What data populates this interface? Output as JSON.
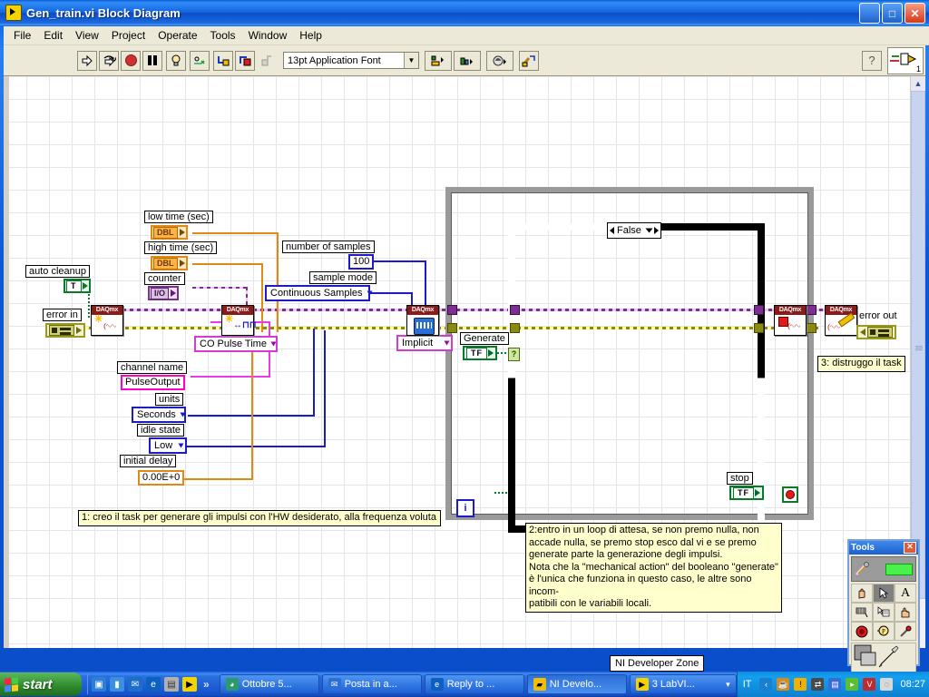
{
  "window": {
    "title": "Gen_train.vi Block Diagram",
    "icon": "labview-vi-icon",
    "minimize": "_",
    "maximize": "□",
    "close": "✕"
  },
  "menu": {
    "items": [
      "File",
      "Edit",
      "View",
      "Project",
      "Operate",
      "Tools",
      "Window",
      "Help"
    ]
  },
  "toolbar": {
    "run": "run-arrow-icon",
    "run_continuous": "run-continuous-icon",
    "abort": "abort-execution-icon",
    "pause": "pause-icon",
    "highlight": "highlight-execution-icon",
    "retain_wire": "retain-wire-values-icon",
    "step_into": "step-into-icon",
    "step_over": "step-over-icon",
    "step_out": "step-out-icon",
    "font": "13pt Application Font",
    "align": "align-objects-icon",
    "distribute": "distribute-objects-icon",
    "reorder": "reorder-icon",
    "cleanup": "clean-up-diagram-icon",
    "help": "?",
    "context_help": "context-help-icon",
    "window_count": "1"
  },
  "diagram": {
    "labels": {
      "low_time": "low time (sec)",
      "high_time": "high time (sec)",
      "counter": "counter",
      "auto_cleanup": "auto cleanup",
      "error_in": "error in",
      "error_out": "error out",
      "number_of_samples": "number of samples",
      "sample_mode": "sample mode",
      "channel_name": "channel name",
      "units": "units",
      "idle_state": "idle state",
      "initial_delay": "initial delay",
      "generate": "Generate",
      "stop": "stop"
    },
    "terminals": {
      "low_time_type": "DBL",
      "high_time_type": "DBL",
      "counter_type": "I/O",
      "auto_cleanup_type": "T",
      "generate_type": "TF",
      "stop_type": "TF"
    },
    "constants": {
      "number_of_samples_value": "100",
      "sample_mode_value": "Continuous Samples",
      "channel_name_value": "PulseOutput",
      "units_value": "Seconds",
      "idle_state_value": "Low",
      "initial_delay_value": "0.00E+0",
      "co_pulse_time_value": "CO Pulse Time",
      "implicit_value": "Implicit"
    },
    "structures": {
      "case_selector": "False",
      "iteration_label": "i"
    },
    "nodes": {
      "create_channel": "DAQmx",
      "timing": "DAQmx",
      "start_task": "DAQmx",
      "stop_task": "DAQmx",
      "clear_task": "DAQmx"
    },
    "comments": {
      "comment1": "1: creo il task per generare gli impulsi con l'HW desiderato, alla frequenza voluta",
      "comment2": "2:entro in un loop di attesa, se non premo nulla, non\naccade nulla, se premo stop esco dal vi e se premo\ngenerate parte la generazione degli impulsi.\nNota che la \"mechanical action\" del booleano \"generate\"\nè l'unica che funziona in questo caso, le altre sono incom-\npatibili con le variabili locali.",
      "comment3": "3: distruggo il task"
    }
  },
  "tooltip": {
    "text": "NI Developer Zone"
  },
  "tools_palette": {
    "title": "Tools",
    "close": "✕",
    "automatic_tool_selection": "automatic-tool-selection-toggle",
    "tools": [
      "operate-value-hand-icon",
      "position-size-select-arrow-icon",
      "edit-text-icon",
      "connect-wire-spool-icon",
      "object-shortcut-menu-icon",
      "scroll-window-hand-icon",
      "set-clear-breakpoint-icon",
      "probe-data-icon",
      "get-color-dropper-icon",
      "set-color-icon",
      "set-color-brush-icon"
    ]
  },
  "taskbar": {
    "start": "start",
    "quick_launch": [
      "show-desktop-icon",
      "media-player-icon",
      "outlook-express-icon",
      "internet-explorer-icon",
      "memory-icon",
      "labview-icon"
    ],
    "chevron": "»",
    "tasks": [
      {
        "label": "Ottobre 5...",
        "icon": "outlook-icon",
        "active": false
      },
      {
        "label": "Posta in a...",
        "icon": "mail-icon",
        "active": false
      },
      {
        "label": "Reply to ...",
        "icon": "internet-explorer-icon",
        "active": false
      },
      {
        "label": "NI Develo...",
        "icon": "folder-icon",
        "active": true
      },
      {
        "label": "3 LabVI...",
        "icon": "labview-icon",
        "active": false
      }
    ],
    "task_group_arrow": "▾",
    "language": "IT",
    "tray_icons": [
      "chevron-left-icon",
      "java-icon",
      "warning-shield-icon",
      "network-icon",
      "network-connections-icon",
      "messenger-icon",
      "antivirus-icon",
      "mouse-icon"
    ],
    "clock": "08:27"
  },
  "colors": {
    "title_blue": "#0a58d6",
    "chrome": "#ece9d8",
    "daqmx_header": "#8b1a1a",
    "error_wire": "#8a8a12",
    "io_wire": "#7b2f8f",
    "numeric_wire": "#e08a16",
    "boolean_wire": "#0a7a2a",
    "blue_constant": "#1b1bc8",
    "pink_constant": "#ff00c8",
    "comment_bg": "#feffcc",
    "loop_gray": "#9a9a9a"
  }
}
